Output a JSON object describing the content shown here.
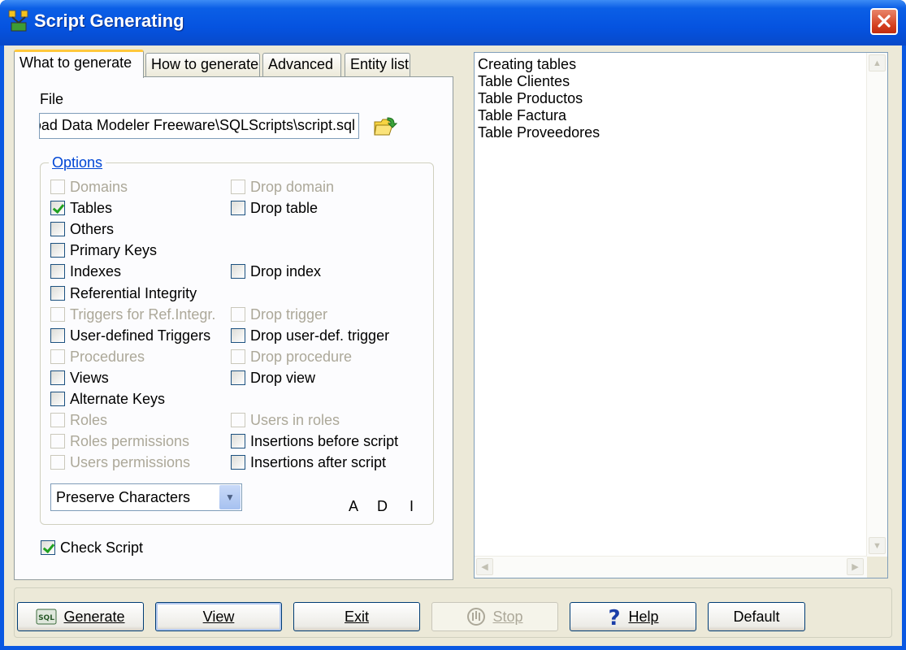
{
  "window": {
    "title": "Script Generating"
  },
  "tabs": [
    {
      "label": "What to generate",
      "active": true
    },
    {
      "label": "How to generate",
      "active": false
    },
    {
      "label": "Advanced",
      "active": false
    },
    {
      "label": "Entity list",
      "active": false
    }
  ],
  "file": {
    "label": "File",
    "value": "oad Data Modeler Freeware\\SQLScripts\\script.sql"
  },
  "options": {
    "legend": "Options",
    "left": [
      {
        "label": "Domains",
        "checked": false,
        "enabled": false
      },
      {
        "label": "Tables",
        "checked": true,
        "enabled": true
      },
      {
        "label": "Others",
        "checked": false,
        "enabled": true
      },
      {
        "label": "Primary Keys",
        "checked": false,
        "enabled": true
      },
      {
        "label": "Indexes",
        "checked": false,
        "enabled": true
      },
      {
        "label": "Referential Integrity",
        "checked": false,
        "enabled": true
      },
      {
        "label": "Triggers for Ref.Integr.",
        "checked": false,
        "enabled": false
      },
      {
        "label": "User-defined Triggers",
        "checked": false,
        "enabled": true
      },
      {
        "label": "Procedures",
        "checked": false,
        "enabled": false
      },
      {
        "label": "Views",
        "checked": false,
        "enabled": true
      },
      {
        "label": "Alternate Keys",
        "checked": false,
        "enabled": true
      },
      {
        "label": "Roles",
        "checked": false,
        "enabled": false
      },
      {
        "label": "Roles permissions",
        "checked": false,
        "enabled": false
      },
      {
        "label": "Users permissions",
        "checked": false,
        "enabled": false
      }
    ],
    "right": [
      {
        "label": "Drop domain",
        "checked": false,
        "enabled": false
      },
      {
        "label": "Drop table",
        "checked": false,
        "enabled": true
      },
      {
        "label": "Drop index",
        "checked": false,
        "enabled": true
      },
      {
        "label": "Drop trigger",
        "checked": false,
        "enabled": false
      },
      {
        "label": "Drop user-def. trigger",
        "checked": false,
        "enabled": true
      },
      {
        "label": "Drop procedure",
        "checked": false,
        "enabled": false
      },
      {
        "label": "Drop view",
        "checked": false,
        "enabled": true
      },
      {
        "label": "Users in roles",
        "checked": false,
        "enabled": false
      },
      {
        "label": "Insertions before script",
        "checked": false,
        "enabled": true
      },
      {
        "label": "Insertions after script",
        "checked": false,
        "enabled": true
      }
    ],
    "case_select": "Preserve Characters",
    "adi": [
      "A",
      "D",
      "I"
    ]
  },
  "check_script": {
    "label": "Check Script",
    "checked": true
  },
  "output_lines": [
    "Creating tables",
    "Table Clientes",
    "Table Productos",
    "Table Factura",
    "Table Proveedores"
  ],
  "buttons": {
    "generate": "Generate",
    "view": "View",
    "exit": "Exit",
    "stop": "Stop",
    "help": "Help",
    "default": "Default"
  },
  "icons": {
    "generate": "sql-icon",
    "stop": "stop-icon",
    "help": "question-icon",
    "browse": "open-folder-icon"
  }
}
